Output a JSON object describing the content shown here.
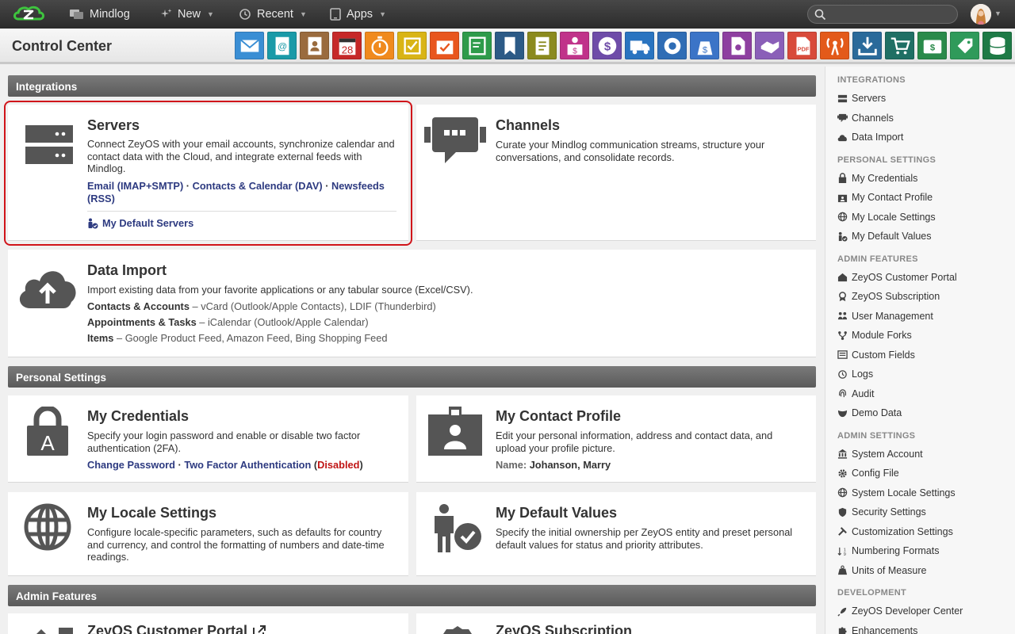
{
  "topbar": {
    "mindlog": "Mindlog",
    "new": "New",
    "recent": "Recent",
    "apps": "Apps",
    "search_placeholder": ""
  },
  "header": {
    "title": "Control Center",
    "apps": [
      {
        "name": "mail-app",
        "color": "#3a8ed4"
      },
      {
        "name": "contacts-app",
        "color": "#1a9aa8"
      },
      {
        "name": "address-book-app",
        "color": "#9a6b3e"
      },
      {
        "name": "calendar-app",
        "color": "#c62828"
      },
      {
        "name": "timer-app",
        "color": "#f08a1e"
      },
      {
        "name": "tasks-app",
        "color": "#d9b416"
      },
      {
        "name": "projects-app",
        "color": "#e8561e"
      },
      {
        "name": "notes-app",
        "color": "#2e9b4a"
      },
      {
        "name": "bookmarks-app",
        "color": "#2c5a86"
      },
      {
        "name": "documents-app",
        "color": "#8b8a1e"
      },
      {
        "name": "sales-app",
        "color": "#c0338a"
      },
      {
        "name": "billing-app",
        "color": "#6e4ca8"
      },
      {
        "name": "shipping-app",
        "color": "#2a74c0"
      },
      {
        "name": "support-app",
        "color": "#2f6db5"
      },
      {
        "name": "finance-app",
        "color": "#3b74c7"
      },
      {
        "name": "campaigns-app",
        "color": "#8e3fa0"
      },
      {
        "name": "deals-app",
        "color": "#8a5fb8"
      },
      {
        "name": "pdf-app",
        "color": "#d84a3a"
      },
      {
        "name": "broadcast-app",
        "color": "#e35a1a"
      },
      {
        "name": "downloads-app",
        "color": "#2a6a9a"
      },
      {
        "name": "shop-app",
        "color": "#1f6f64"
      },
      {
        "name": "payments-app",
        "color": "#2a8a4a"
      },
      {
        "name": "pricing-app",
        "color": "#2f9a5a"
      },
      {
        "name": "database-app",
        "color": "#1e7a46"
      }
    ]
  },
  "integrations": {
    "section": "Integrations",
    "servers": {
      "title": "Servers",
      "desc": "Connect ZeyOS with your email accounts, synchronize calendar and contact data with the Cloud, and integrate external feeds with Mindlog.",
      "link1": "Email (IMAP+SMTP)",
      "link2": "Contacts & Calendar (DAV)",
      "link3": "Newsfeeds (RSS)",
      "sep": "·",
      "default": "My Default Servers"
    },
    "channels": {
      "title": "Channels",
      "desc": "Curate your Mindlog communication streams, structure your conversations, and consolidate records."
    },
    "import": {
      "title": "Data Import",
      "desc": "Import existing data from your favorite applications or any tabular source (Excel/CSV).",
      "rows": [
        {
          "k": "Contacts & Accounts",
          "v": "vCard (Outlook/Apple Contacts), LDIF (Thunderbird)"
        },
        {
          "k": "Appointments & Tasks",
          "v": "iCalendar (Outlook/Apple Calendar)"
        },
        {
          "k": "Items",
          "v": "Google Product Feed, Amazon Feed, Bing Shopping Feed"
        }
      ],
      "dash": "–"
    }
  },
  "personal": {
    "section": "Personal Settings",
    "credentials": {
      "title": "My Credentials",
      "desc": "Specify your login password and enable or disable two factor authentication (2FA).",
      "link1": "Change Password",
      "link2": "Two Factor Authentication",
      "status": "Disabled"
    },
    "contact": {
      "title": "My Contact Profile",
      "desc": "Edit your personal information, address and contact data, and upload your profile picture.",
      "name_label": "Name:",
      "name": "Johanson, Marry"
    },
    "locale": {
      "title": "My Locale Settings",
      "desc": "Configure locale-specific parameters, such as defaults for country and currency, and control the formatting of numbers and date-time readings."
    },
    "defaults": {
      "title": "My Default Values",
      "desc": "Specify the initial ownership per ZeyOS entity and preset personal default values for status and priority attributes."
    }
  },
  "admin": {
    "section": "Admin Features",
    "portal": "ZeyOS Customer Portal",
    "subscription": "ZeyOS Subscription"
  },
  "sidebar": {
    "groups": [
      {
        "title": "INTEGRATIONS",
        "items": [
          {
            "label": "Servers",
            "icon": "server-icon"
          },
          {
            "label": "Channels",
            "icon": "channel-icon"
          },
          {
            "label": "Data Import",
            "icon": "cloud-upload-icon"
          }
        ]
      },
      {
        "title": "PERSONAL SETTINGS",
        "items": [
          {
            "label": "My Credentials",
            "icon": "lock-icon"
          },
          {
            "label": "My Contact Profile",
            "icon": "id-card-icon"
          },
          {
            "label": "My Locale Settings",
            "icon": "globe-icon"
          },
          {
            "label": "My Default Values",
            "icon": "user-check-icon"
          }
        ]
      },
      {
        "title": "ADMIN FEATURES",
        "items": [
          {
            "label": "ZeyOS Customer Portal",
            "icon": "home-icon"
          },
          {
            "label": "ZeyOS Subscription",
            "icon": "badge-icon"
          },
          {
            "label": "User Management",
            "icon": "users-icon"
          },
          {
            "label": "Module Forks",
            "icon": "fork-icon"
          },
          {
            "label": "Custom Fields",
            "icon": "fields-icon"
          },
          {
            "label": "Logs",
            "icon": "history-icon"
          },
          {
            "label": "Audit",
            "icon": "fingerprint-icon"
          },
          {
            "label": "Demo Data",
            "icon": "mask-icon"
          }
        ]
      },
      {
        "title": "ADMIN SETTINGS",
        "items": [
          {
            "label": "System Account",
            "icon": "bank-icon"
          },
          {
            "label": "Config File",
            "icon": "gear-icon"
          },
          {
            "label": "System Locale Settings",
            "icon": "globe-icon"
          },
          {
            "label": "Security Settings",
            "icon": "shield-icon"
          },
          {
            "label": "Customization Settings",
            "icon": "tools-icon"
          },
          {
            "label": "Numbering Formats",
            "icon": "sort-numeric-icon"
          },
          {
            "label": "Units of Measure",
            "icon": "weight-icon"
          }
        ]
      },
      {
        "title": "DEVELOPMENT",
        "items": [
          {
            "label": "ZeyOS Developer Center",
            "icon": "rocket-icon"
          },
          {
            "label": "Enhancements",
            "icon": "puzzle-icon"
          }
        ]
      }
    ]
  }
}
